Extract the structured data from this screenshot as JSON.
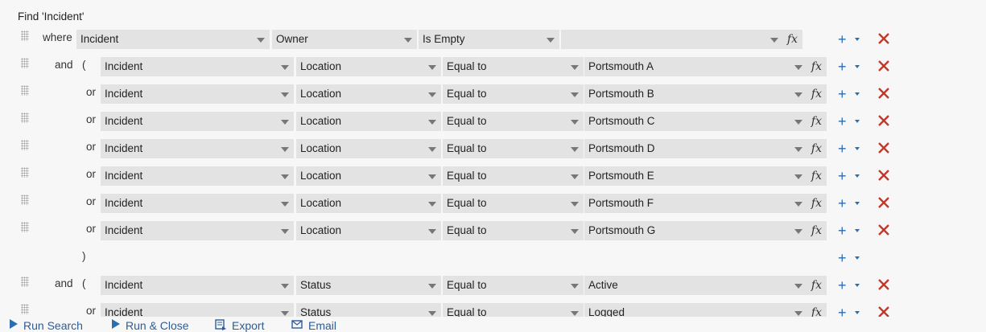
{
  "title": "Find 'Incident'",
  "rows": [
    {
      "connector": "where",
      "paren": "",
      "fields": [
        "Incident",
        "Owner",
        "Is Empty",
        ""
      ]
    },
    {
      "connector": "and",
      "paren": "(",
      "fields": [
        "Incident",
        "Location",
        "Equal to",
        "Portsmouth A"
      ]
    },
    {
      "connector": "or",
      "paren": "",
      "fields": [
        "Incident",
        "Location",
        "Equal to",
        "Portsmouth B"
      ]
    },
    {
      "connector": "or",
      "paren": "",
      "fields": [
        "Incident",
        "Location",
        "Equal to",
        "Portsmouth C"
      ]
    },
    {
      "connector": "or",
      "paren": "",
      "fields": [
        "Incident",
        "Location",
        "Equal to",
        "Portsmouth D"
      ]
    },
    {
      "connector": "or",
      "paren": "",
      "fields": [
        "Incident",
        "Location",
        "Equal to",
        "Portsmouth E"
      ]
    },
    {
      "connector": "or",
      "paren": "",
      "fields": [
        "Incident",
        "Location",
        "Equal to",
        "Portsmouth F"
      ]
    },
    {
      "connector": "or",
      "paren": "",
      "fields": [
        "Incident",
        "Location",
        "Equal to",
        "Portsmouth G"
      ]
    },
    {
      "connector": "",
      "paren": ")",
      "fields": []
    },
    {
      "connector": "and",
      "paren": "(",
      "fields": [
        "Incident",
        "Status",
        "Equal to",
        "Active"
      ]
    },
    {
      "connector": "or",
      "paren": "",
      "fields": [
        "Incident",
        "Status",
        "Equal to",
        "Logged"
      ]
    }
  ],
  "fx_label": "fx",
  "toolbar": {
    "run_search": "Run Search",
    "run_close": "Run & Close",
    "export": "Export",
    "email": "Email"
  },
  "icons": {
    "add": "plus-icon",
    "delete": "x-icon",
    "grip": "drag-handle-icon"
  },
  "colors": {
    "accent": "#2a6db0",
    "delete": "#c0392b",
    "field_bg": "#e3e3e3"
  }
}
